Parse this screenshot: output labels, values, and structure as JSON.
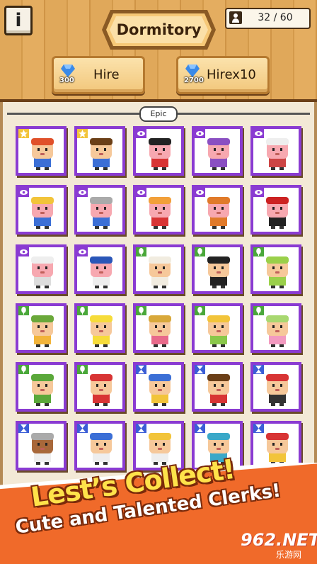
{
  "header": {
    "info_label": "i",
    "title": "Dormitory",
    "capacity": "32 / 60",
    "hire_label": "Hire",
    "hire_cost": "300",
    "hire10_label": "Hirex10",
    "hire10_cost": "2700"
  },
  "section": {
    "tier": "Epic"
  },
  "colors": {
    "card_border": "#8a3bd2",
    "wood": "#e0a85a",
    "banner": "#f06a2a",
    "headline": "#ffe24a"
  },
  "cards": [
    {
      "badge": "star",
      "hair": "#e0502a",
      "skin": "#f6c89a",
      "shirt": "#3b6fd6"
    },
    {
      "badge": "star",
      "hair": "#6b3f17",
      "skin": "#f6c89a",
      "shirt": "#3b6fd6"
    },
    {
      "badge": "eye",
      "hair": "#222222",
      "skin": "#f7a8b0",
      "shirt": "#d83434"
    },
    {
      "badge": "eye",
      "hair": "#8a4fc2",
      "skin": "#f7a8b0",
      "shirt": "#8a4fc2"
    },
    {
      "badge": "eye",
      "hair": "#eeeeee",
      "skin": "#f7a8b0",
      "shirt": "#cc4444"
    },
    {
      "badge": "eye",
      "hair": "#f2c43a",
      "skin": "#f7a8b0",
      "shirt": "#3b6fd6"
    },
    {
      "badge": "eye",
      "hair": "#aaaaaa",
      "skin": "#f7a8b0",
      "shirt": "#3b6fd6"
    },
    {
      "badge": "eye",
      "hair": "#f2a03a",
      "skin": "#f7a8b0",
      "shirt": "#d83434"
    },
    {
      "badge": "eye",
      "hair": "#e07a2a",
      "skin": "#f7a8b0",
      "shirt": "#e07a2a"
    },
    {
      "badge": "eye",
      "hair": "#cc2222",
      "skin": "#f7a8b0",
      "shirt": "#222222"
    },
    {
      "badge": "eye",
      "hair": "#eeeeee",
      "skin": "#f7a8b0",
      "shirt": "#dddddd"
    },
    {
      "badge": "eye",
      "hair": "#2a56b8",
      "skin": "#f7a8b0",
      "shirt": "#eeeeee"
    },
    {
      "badge": "leaf",
      "hair": "#f1ece0",
      "skin": "#f6c89a",
      "shirt": "#f1ece0"
    },
    {
      "badge": "leaf",
      "hair": "#222222",
      "skin": "#f6c89a",
      "shirt": "#222222"
    },
    {
      "badge": "leaf",
      "hair": "#9ad04a",
      "skin": "#f6c89a",
      "shirt": "#9ad04a"
    },
    {
      "badge": "leaf",
      "hair": "#6aa83a",
      "skin": "#f6c89a",
      "shirt": "#f2b43a"
    },
    {
      "badge": "leaf",
      "hair": "#f6dc3a",
      "skin": "#f6c89a",
      "shirt": "#f6dc3a"
    },
    {
      "badge": "leaf",
      "hair": "#d8a83a",
      "skin": "#f6c89a",
      "shirt": "#e86a8a"
    },
    {
      "badge": "leaf",
      "hair": "#f2c43a",
      "skin": "#f6c89a",
      "shirt": "#8ac84a"
    },
    {
      "badge": "leaf",
      "hair": "#a8d870",
      "skin": "#f6c89a",
      "shirt": "#f29ac0"
    },
    {
      "badge": "leaf",
      "hair": "#5aa83a",
      "skin": "#f6c89a",
      "shirt": "#5aa83a"
    },
    {
      "badge": "leaf",
      "hair": "#d83434",
      "skin": "#f6c89a",
      "shirt": "#d83434"
    },
    {
      "badge": "hourglass",
      "hair": "#3b6fd6",
      "skin": "#f6c89a",
      "shirt": "#f2c43a"
    },
    {
      "badge": "hourglass",
      "hair": "#6b3f17",
      "skin": "#f6c89a",
      "shirt": "#d83434"
    },
    {
      "badge": "hourglass",
      "hair": "#d83434",
      "skin": "#f6c89a",
      "shirt": "#333333"
    },
    {
      "badge": "hourglass",
      "hair": "#aaaaaa",
      "skin": "#a8683a",
      "shirt": "#eeeeee"
    },
    {
      "badge": "hourglass",
      "hair": "#3b6fd6",
      "skin": "#f6c89a",
      "shirt": "#eeeeee"
    },
    {
      "badge": "hourglass",
      "hair": "#f2c43a",
      "skin": "#f6c89a",
      "shirt": "#eeeeee"
    },
    {
      "badge": "hourglass",
      "hair": "#3aa8c8",
      "skin": "#f6c89a",
      "shirt": "#3aa8c8"
    },
    {
      "badge": "hourglass",
      "hair": "#d83434",
      "skin": "#f6c89a",
      "shirt": "#f2c43a"
    }
  ],
  "banner": {
    "headline": "Lest’s Collect!",
    "subline": "Cute and Talented Clerks!"
  },
  "watermark": {
    "brand": "962.NET",
    "site": "乐游网"
  }
}
